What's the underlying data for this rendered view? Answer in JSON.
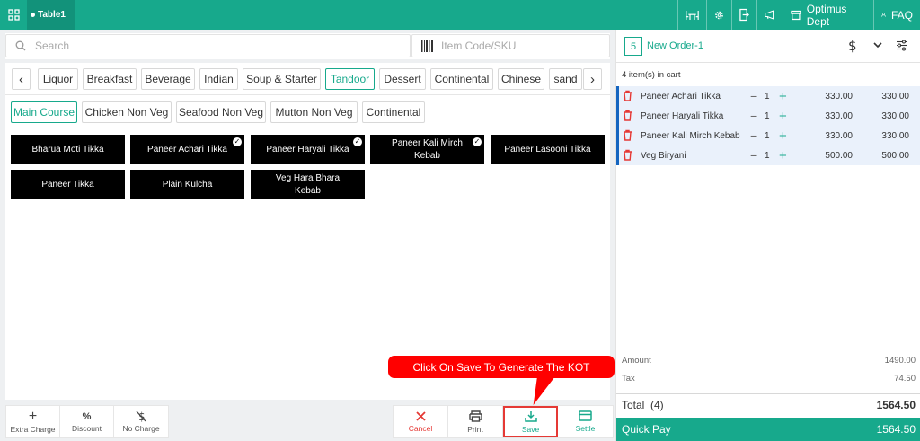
{
  "topbar": {
    "table_label": "Table1",
    "dept_label": "Optimus Dept",
    "faq_label": "FAQ"
  },
  "search": {
    "placeholder": "Search",
    "sku_placeholder": "Item Code/SKU"
  },
  "categories": [
    "Liquor",
    "Breakfast",
    "Beverage",
    "Indian",
    "Soup & Starter",
    "Tandoor",
    "Dessert",
    "Continental",
    "Chinese",
    "sand"
  ],
  "active_category": "Tandoor",
  "subcategories": [
    "Main Course",
    "Chicken Non Veg",
    "Seafood Non Veg",
    "Mutton Non Veg",
    "Continental"
  ],
  "active_subcategory": "Main Course",
  "items": [
    {
      "name": "Bharua Moti Tikka",
      "selected": false
    },
    {
      "name": "Paneer Achari Tikka",
      "selected": true
    },
    {
      "name": "Paneer Haryali Tikka",
      "selected": true
    },
    {
      "name": "Paneer Kali Mirch Kebab",
      "selected": true
    },
    {
      "name": "Paneer Lasooni Tikka",
      "selected": false
    },
    {
      "name": "Paneer Tikka",
      "selected": false
    },
    {
      "name": "Plain Kulcha",
      "selected": false
    },
    {
      "name": "Veg Hara Bhara Kebab",
      "selected": false
    }
  ],
  "bottom_left": {
    "extra_charge": "Extra Charge",
    "discount": "Discount",
    "no_charge": "No Charge"
  },
  "bottom_right": {
    "cancel": "Cancel",
    "print": "Print",
    "save": "Save",
    "settle": "Settle"
  },
  "callout": "Click On Save To Generate The KOT",
  "order": {
    "number": "5",
    "title": "New Order-1",
    "cart_count": "4 item(s) in cart",
    "items": [
      {
        "name": "Paneer Achari Tikka",
        "qty": "1",
        "price": "330.00",
        "total": "330.00"
      },
      {
        "name": "Paneer Haryali Tikka",
        "qty": "1",
        "price": "330.00",
        "total": "330.00"
      },
      {
        "name": "Paneer Kali Mirch Kebab",
        "qty": "1",
        "price": "330.00",
        "total": "330.00"
      },
      {
        "name": "Veg Biryani",
        "qty": "1",
        "price": "500.00",
        "total": "500.00"
      }
    ],
    "amount_label": "Amount",
    "amount": "1490.00",
    "tax_label": "Tax",
    "tax": "74.50",
    "total_label": "Total  (4)",
    "total": "1564.50",
    "quickpay_label": "Quick Pay",
    "quickpay_value": "1564.50"
  },
  "colors": {
    "accent": "#17a98c",
    "danger": "#e53935",
    "callout": "#ff0000",
    "cart_border": "#1565c0"
  }
}
